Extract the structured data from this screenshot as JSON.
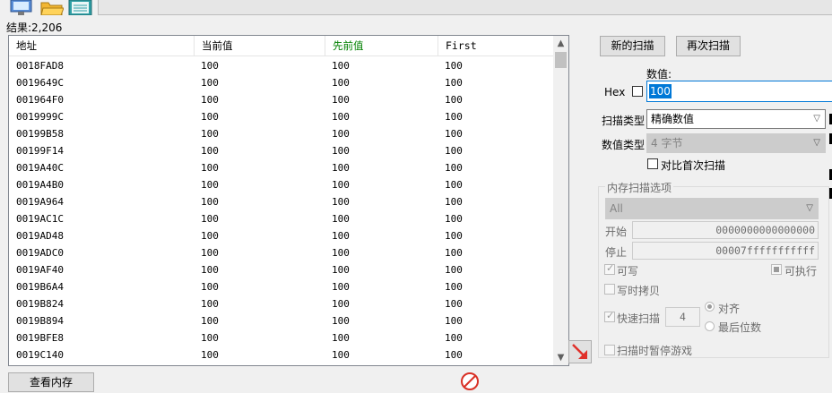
{
  "toolbar": {
    "icons": [
      "computer-icon",
      "open-folder-icon",
      "save-icon"
    ]
  },
  "result_text": "结果:2,206",
  "list": {
    "headers": {
      "address": "地址",
      "current": "当前值",
      "previous": "先前值",
      "first": "First"
    },
    "rows": [
      {
        "address": "0018FAD8",
        "current": "100",
        "previous": "100",
        "first": "100"
      },
      {
        "address": "0019649C",
        "current": "100",
        "previous": "100",
        "first": "100"
      },
      {
        "address": "001964F0",
        "current": "100",
        "previous": "100",
        "first": "100"
      },
      {
        "address": "0019999C",
        "current": "100",
        "previous": "100",
        "first": "100"
      },
      {
        "address": "00199B58",
        "current": "100",
        "previous": "100",
        "first": "100"
      },
      {
        "address": "00199F14",
        "current": "100",
        "previous": "100",
        "first": "100"
      },
      {
        "address": "0019A40C",
        "current": "100",
        "previous": "100",
        "first": "100"
      },
      {
        "address": "0019A4B0",
        "current": "100",
        "previous": "100",
        "first": "100"
      },
      {
        "address": "0019A964",
        "current": "100",
        "previous": "100",
        "first": "100"
      },
      {
        "address": "0019AC1C",
        "current": "100",
        "previous": "100",
        "first": "100"
      },
      {
        "address": "0019AD48",
        "current": "100",
        "previous": "100",
        "first": "100"
      },
      {
        "address": "0019ADC0",
        "current": "100",
        "previous": "100",
        "first": "100"
      },
      {
        "address": "0019AF40",
        "current": "100",
        "previous": "100",
        "first": "100"
      },
      {
        "address": "0019B6A4",
        "current": "100",
        "previous": "100",
        "first": "100"
      },
      {
        "address": "0019B824",
        "current": "100",
        "previous": "100",
        "first": "100"
      },
      {
        "address": "0019B894",
        "current": "100",
        "previous": "100",
        "first": "100"
      },
      {
        "address": "0019BFE8",
        "current": "100",
        "previous": "100",
        "first": "100"
      },
      {
        "address": "0019C140",
        "current": "100",
        "previous": "100",
        "first": "100"
      }
    ]
  },
  "buttons": {
    "new_scan": "新的扫描",
    "next_scan": "再次扫描",
    "view_memory": "查看内存"
  },
  "value": {
    "label": "数值:",
    "hex_label": "Hex",
    "input_value": "100"
  },
  "scan_type": {
    "label": "扫描类型",
    "value": "精确数值"
  },
  "value_type": {
    "label": "数值类型",
    "value": "4 字节"
  },
  "compare_first": "对比首次扫描",
  "memory_options": {
    "title": "内存扫描选项",
    "region": "All",
    "start_label": "开始",
    "start_value": "0000000000000000",
    "stop_label": "停止",
    "stop_value": "00007fffffffffff",
    "writable": "可写",
    "executable": "可执行",
    "copy_on_write": "写时拷贝",
    "fast_scan": "快速扫描",
    "fast_scan_value": "4",
    "align": "对齐",
    "last_digits": "最后位数",
    "pause_game": "扫描时暂停游戏"
  },
  "colors": {
    "previous_header": "#008000",
    "accent": "#0078d7",
    "arrow": "#e0302a"
  }
}
